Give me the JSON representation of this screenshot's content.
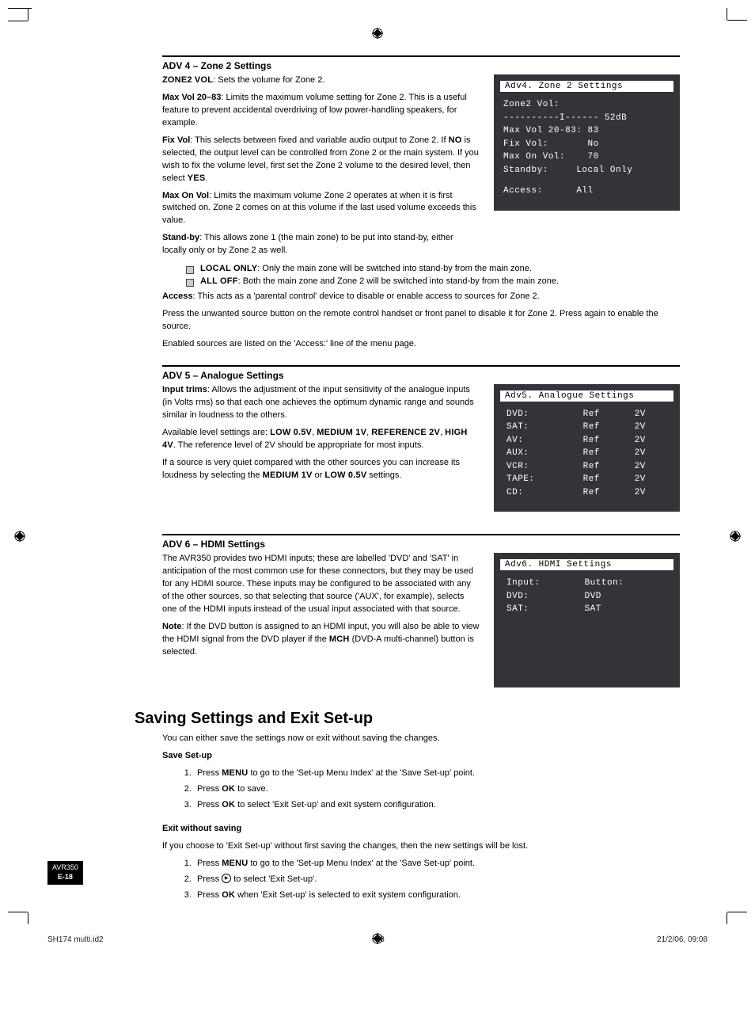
{
  "sections": {
    "adv4": {
      "head": "ADV 4 – Zone 2 Settings",
      "p1a": "ZONE2 VOL",
      "p1b": ": Sets the volume for Zone 2.",
      "p2a": "Max Vol 20–83",
      "p2b": ": Limits the maximum volume setting for Zone 2. This is a useful feature to prevent accidental overdriving of low power-handling speakers, for example.",
      "p3a": "Fix Vol",
      "p3b": ": This selects between fixed and variable audio output to Zone 2. If ",
      "p3c": "NO",
      "p3d": " is selected, the output level can be controlled from Zone 2 or the main system. If you wish to fix the volume level, first set the Zone 2 volume to the desired level, then select ",
      "p3e": "YES",
      "p3f": ".",
      "p4a": "Max On Vol",
      "p4b": ": Limits the maximum volume Zone 2 operates at when it is first switched on. Zone 2 comes on at this volume if the last used volume exceeds this value.",
      "p5a": "Stand-by",
      "p5b": ": This allows zone 1 (the main zone) to be put into stand-by, either locally only or by Zone 2 as well.",
      "li1a": "LOCAL ONLY",
      "li1b": ": Only the main zone will be switched into stand-by from the main zone.",
      "li2a": "ALL OFF",
      "li2b": ": Both the main zone and Zone 2 will be switched into stand-by from the main zone.",
      "p6a": "Access",
      "p6b": ": This acts as a 'parental control' device to disable or enable access to sources for Zone 2.",
      "p7": "Press the unwanted source button on the remote control handset or front panel to disable it for Zone 2. Press again to enable the source.",
      "p8": "Enabled sources are listed on the 'Access:' line of the menu page."
    },
    "adv5": {
      "head": "ADV 5 – Analogue Settings",
      "p1a": "Input trims",
      "p1b": ": Allows the adjustment of the input sensitivity of the analogue inputs (in Volts rms) so that each one achieves the optimum dynamic range and sounds similar in loudness to the others.",
      "p2a": "Available level settings are: ",
      "p2b": "LOW 0.5V",
      "p2c": ", ",
      "p2d": "MEDIUM 1V",
      "p2e": ", ",
      "p2f": "REFERENCE 2V",
      "p2g": ", ",
      "p2h": "HIGH 4V",
      "p2i": ". The reference level of 2V should be appropriate for most inputs.",
      "p3a": "If a source is very quiet compared with the other sources you can increase its loudness by selecting the ",
      "p3b": "MEDIUM 1V",
      "p3c": " or ",
      "p3d": "LOW 0.5V",
      "p3e": " settings."
    },
    "adv6": {
      "head": "ADV 6 – HDMI Settings",
      "p1": "The AVR350 provides two HDMI inputs; these are labelled 'DVD' and 'SAT' in anticipation of the most common use for these connectors, but they may be used for any HDMI source. These inputs may be configured to be associated with any of the other sources, so that selecting that source ('AUX', for example), selects one of the HDMI inputs instead of the usual input associated with that source.",
      "p2a": "Note",
      "p2b": ": If the DVD button is assigned to an HDMI input, you will also be able to view the HDMI signal from the DVD player if the ",
      "p2c": "MCH",
      "p2d": " (DVD-A multi-channel) button is selected."
    },
    "saving": {
      "title": "Saving Settings and Exit Set-up",
      "intro": "You can either save the settings now or exit without saving the changes.",
      "save_head": "Save Set-up",
      "s1a": "Press ",
      "s1b": "MENU",
      "s1c": " to go to the 'Set-up Menu Index' at the 'Save Set-up' point.",
      "s2a": "Press ",
      "s2b": "OK",
      "s2c": " to save.",
      "s3a": "Press ",
      "s3b": "OK",
      "s3c": " to select 'Exit Set-up' and exit system configuration.",
      "exit_head": "Exit without saving",
      "exit_intro": "If you choose to 'Exit Set-up' without first saving the changes, then the new settings will be lost.",
      "e1a": "Press ",
      "e1b": "MENU",
      "e1c": " to go to the 'Set-up Menu Index' at the 'Save Set-up' point.",
      "e2a": "Press ",
      "e2b": " to select 'Exit Set-up'.",
      "e3a": "Press ",
      "e3b": "OK",
      "e3c": " when 'Exit Set-up' is selected to exit system configuration."
    }
  },
  "osd": {
    "adv4": {
      "title": "Adv4. Zone 2 Settings",
      "l1": "Zone2 Vol:",
      "l2": "----------I------ 52dB",
      "l3": "Max Vol 20-83: 83",
      "l4": "Fix Vol:       No",
      "l5": "Max On Vol:    70",
      "l6": "Standby:     Local Only",
      "l7": "Access:      All"
    },
    "adv5": {
      "title": "Adv5. Analogue Settings",
      "rows": [
        {
          "a": "DVD:",
          "b": "Ref",
          "c": "2V"
        },
        {
          "a": "SAT:",
          "b": "Ref",
          "c": "2V"
        },
        {
          "a": "AV:",
          "b": "Ref",
          "c": "2V"
        },
        {
          "a": "AUX:",
          "b": "Ref",
          "c": "2V"
        },
        {
          "a": "VCR:",
          "b": "Ref",
          "c": "2V"
        },
        {
          "a": "TAPE:",
          "b": "Ref",
          "c": "2V"
        },
        {
          "a": "CD:",
          "b": "Ref",
          "c": "2V"
        }
      ]
    },
    "adv6": {
      "title": "Adv6. HDMI Settings",
      "h1": "Input:",
      "h2": "Button:",
      "r1a": "DVD:",
      "r1b": "DVD",
      "r2a": "SAT:",
      "r2b": "SAT"
    }
  },
  "pagebadge": {
    "model": "AVR350",
    "page": "E-18"
  },
  "footer": {
    "left": "SH174 multi.id2",
    "mid": "18",
    "right": "21/2/06, 09:08"
  }
}
